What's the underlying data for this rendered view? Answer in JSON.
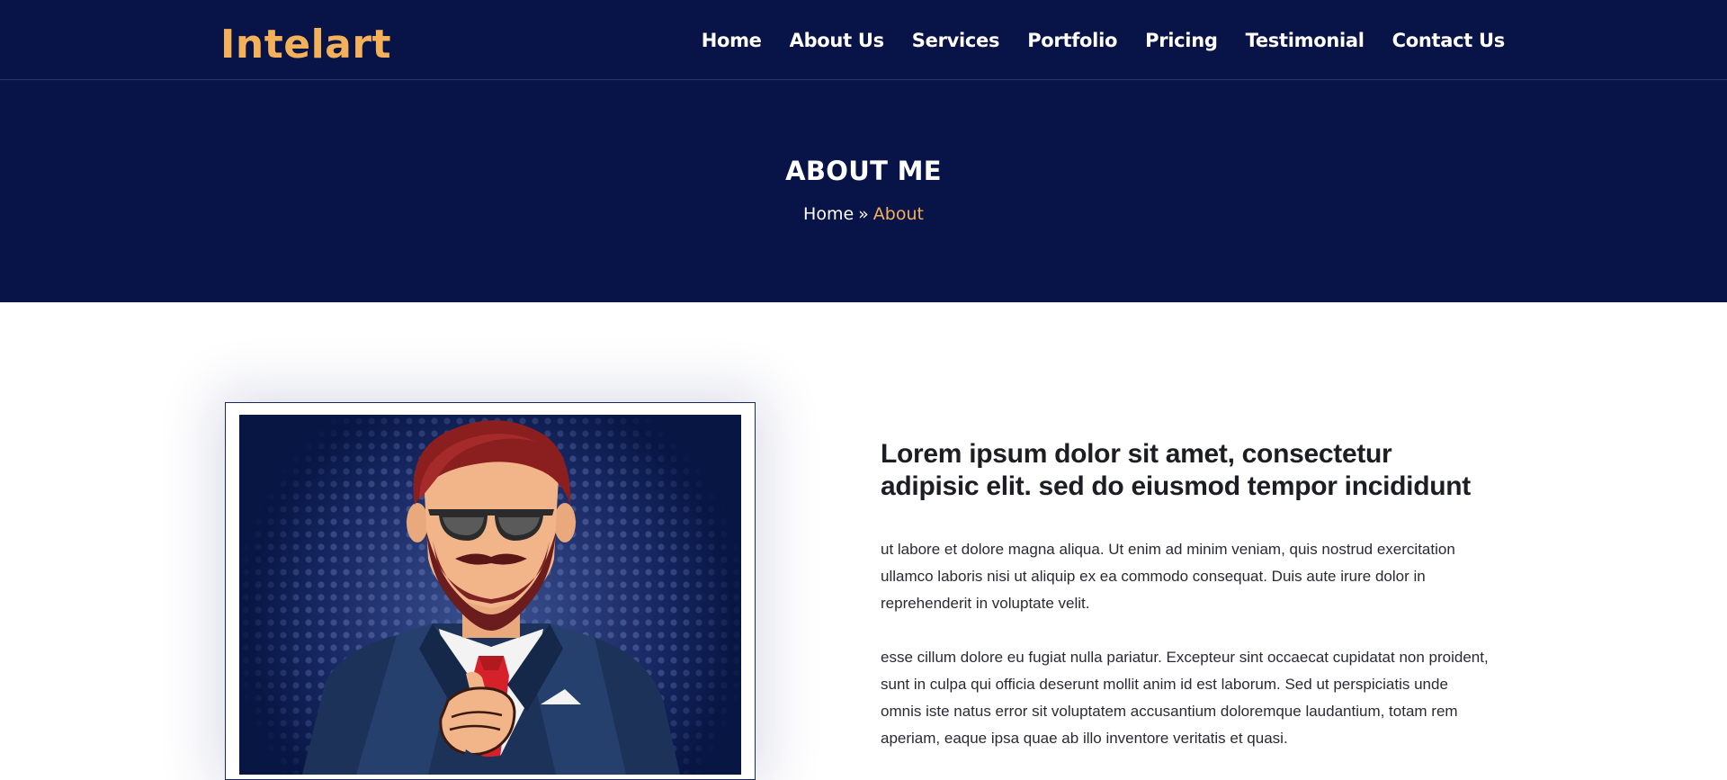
{
  "brand": {
    "logo_text": "Intelart",
    "accent_color": "#f4b15a",
    "navy_color": "#081347"
  },
  "nav": {
    "items": [
      {
        "label": "Home"
      },
      {
        "label": "About Us"
      },
      {
        "label": "Services"
      },
      {
        "label": "Portfolio"
      },
      {
        "label": "Pricing"
      },
      {
        "label": "Testimonial"
      },
      {
        "label": "Contact Us"
      }
    ]
  },
  "banner": {
    "title": "ABOUT ME",
    "breadcrumb": {
      "home": "Home",
      "separator": "»",
      "current": "About"
    }
  },
  "about": {
    "image_icon": "bearded-businessman-pointing-illustration",
    "heading": "Lorem ipsum dolor sit amet, consectetur adipisic elit. sed do eiusmod tempor incididunt",
    "paragraphs": [
      "ut labore et dolore magna aliqua. Ut enim ad minim veniam, quis nostrud exercitation ullamco laboris nisi ut aliquip ex ea commodo consequat. Duis aute irure dolor in reprehenderit in voluptate velit.",
      "esse cillum dolore eu fugiat nulla pariatur. Excepteur sint occaecat cupidatat non proident, sunt in culpa qui officia deserunt mollit anim id est laborum. Sed ut perspiciatis unde omnis iste natus error sit voluptatem accusantium doloremque laudantium, totam rem aperiam, eaque ipsa quae ab illo inventore veritatis et quasi."
    ]
  }
}
